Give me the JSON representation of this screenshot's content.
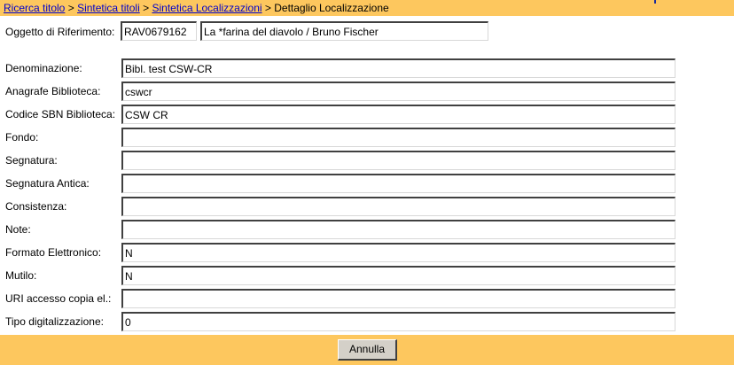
{
  "breadcrumb": {
    "items": [
      "Ricerca titolo",
      "Sintetica titoli",
      "Sintetica Localizzazioni"
    ],
    "separator": ">",
    "current": "Dettaglio Localizzazione"
  },
  "reference": {
    "label": "Oggetto di Riferimento:",
    "code": "RAV0679162",
    "title": "La *farina del diavolo / Bruno Fischer"
  },
  "fields": [
    {
      "label": "Denominazione:",
      "value": "Bibl. test CSW-CR"
    },
    {
      "label": "Anagrafe Biblioteca:",
      "value": "cswcr"
    },
    {
      "label": "Codice SBN Biblioteca:",
      "value": "CSW CR"
    },
    {
      "label": "Fondo:",
      "value": ""
    },
    {
      "label": "Segnatura:",
      "value": ""
    },
    {
      "label": "Segnatura Antica:",
      "value": ""
    },
    {
      "label": "Consistenza:",
      "value": ""
    },
    {
      "label": "Note:",
      "value": ""
    },
    {
      "label": "Formato Elettronico:",
      "value": "N"
    },
    {
      "label": "Mutilo:",
      "value": "N"
    },
    {
      "label": "URI accesso copia el.:",
      "value": ""
    },
    {
      "label": "Tipo digitalizzazione:",
      "value": "0"
    }
  ],
  "footer": {
    "cancel_label": "Annulla"
  },
  "colors": {
    "bar": "#fdc75e",
    "link": "#0000cc",
    "button": "#d4d0c8"
  }
}
